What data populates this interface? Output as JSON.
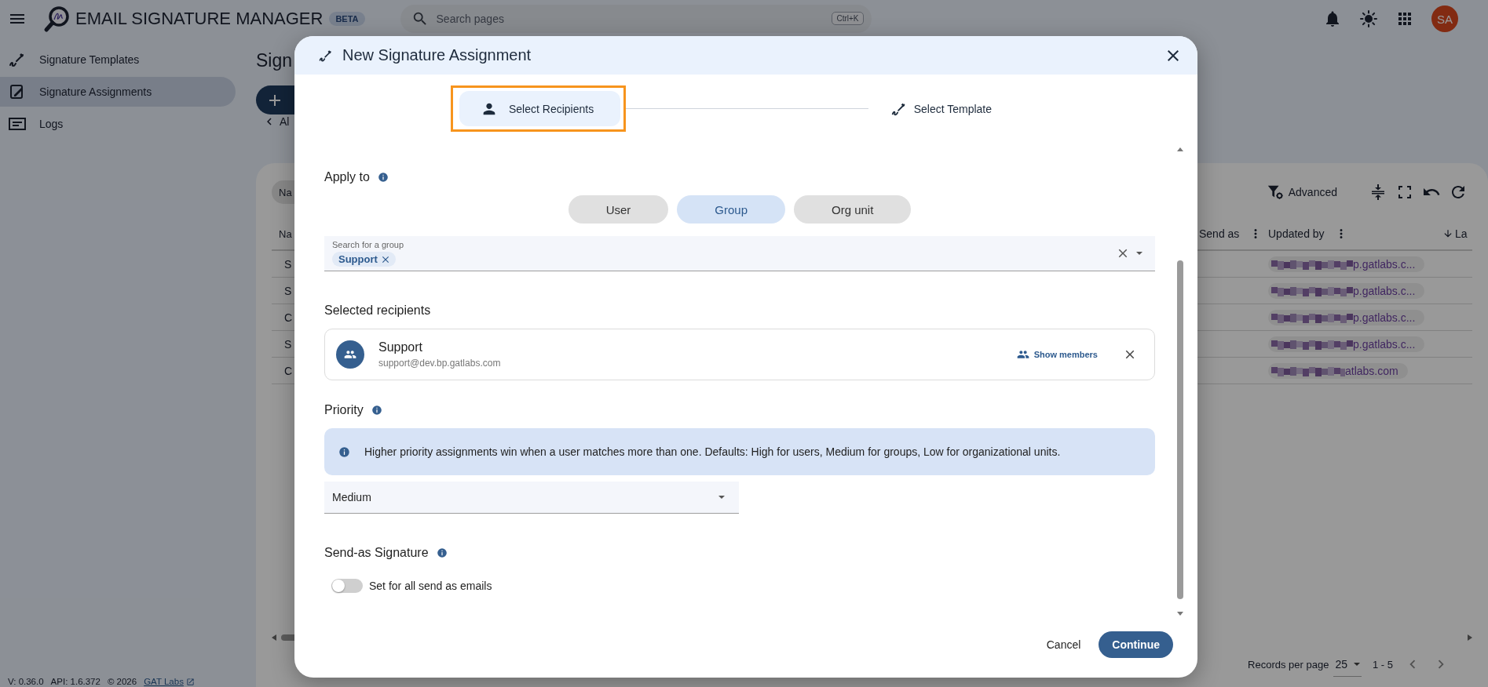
{
  "header": {
    "app_title": "EMAIL SIGNATURE MANAGER",
    "badge": "BETA",
    "search": {
      "placeholder": "Search pages",
      "shortcut": "Ctrl+K"
    },
    "avatar": "SA"
  },
  "sidebar": {
    "items": [
      {
        "label": "Signature Templates",
        "selected": false,
        "kind": "templates"
      },
      {
        "label": "Signature Assignments",
        "selected": true,
        "kind": "assignments"
      },
      {
        "label": "Logs",
        "selected": false,
        "kind": "logs"
      }
    ],
    "footer": {
      "version": "V: 0.36.0",
      "api": "API: 1.6.372",
      "copyright": "© 2026",
      "link": "GAT Labs"
    }
  },
  "page": {
    "title": "Sign",
    "back_link": "Al",
    "filter_chip": "Na",
    "advanced": "Advanced",
    "table": {
      "columns": [
        {
          "label": "Na",
          "kind": "plain"
        },
        {
          "label": "Send as",
          "kind": "menu"
        },
        {
          "label": "Updated by",
          "kind": "menu"
        },
        {
          "label": "La",
          "kind": "sorted"
        }
      ],
      "rows": [
        {
          "name": "S",
          "updated_by": "p.gatlabs.c..."
        },
        {
          "name": "S",
          "updated_by": "p.gatlabs.c..."
        },
        {
          "name": "C",
          "updated_by": "p.gatlabs.c..."
        },
        {
          "name": "S",
          "updated_by": "p.gatlabs.c..."
        },
        {
          "name": "C",
          "updated_by": "atlabs.com"
        }
      ]
    },
    "pagination": {
      "label": "Records per page",
      "page_size": "25",
      "range": "1 - 5"
    }
  },
  "dialog": {
    "title": "New Signature Assignment",
    "steps": [
      {
        "label": "Select Recipients",
        "kind": "recipients",
        "active": true,
        "highlighted": true
      },
      {
        "label": "Select Template",
        "kind": "template",
        "active": false,
        "highlighted": false
      }
    ],
    "apply_to": {
      "label": "Apply to",
      "options": [
        {
          "label": "User",
          "selected": false
        },
        {
          "label": "Group",
          "selected": true
        },
        {
          "label": "Org unit",
          "selected": false
        }
      ]
    },
    "group_search": {
      "label": "Search for a group",
      "chips": [
        "Support"
      ]
    },
    "selected_recipients": {
      "label": "Selected recipients",
      "items": [
        {
          "name": "Support",
          "email": "support@dev.bp.gatlabs.com",
          "action": "Show members"
        }
      ]
    },
    "priority": {
      "label": "Priority",
      "info": "Higher priority assignments win when a user matches more than one. Defaults: High for users, Medium for groups, Low for organizational units.",
      "value": "Medium"
    },
    "send_as": {
      "label": "Send-as Signature",
      "toggle_label": "Set for all send as emails",
      "on": false
    },
    "buttons": [
      {
        "label": "Cancel",
        "kind": "text"
      },
      {
        "label": "Continue",
        "kind": "primary"
      }
    ]
  }
}
